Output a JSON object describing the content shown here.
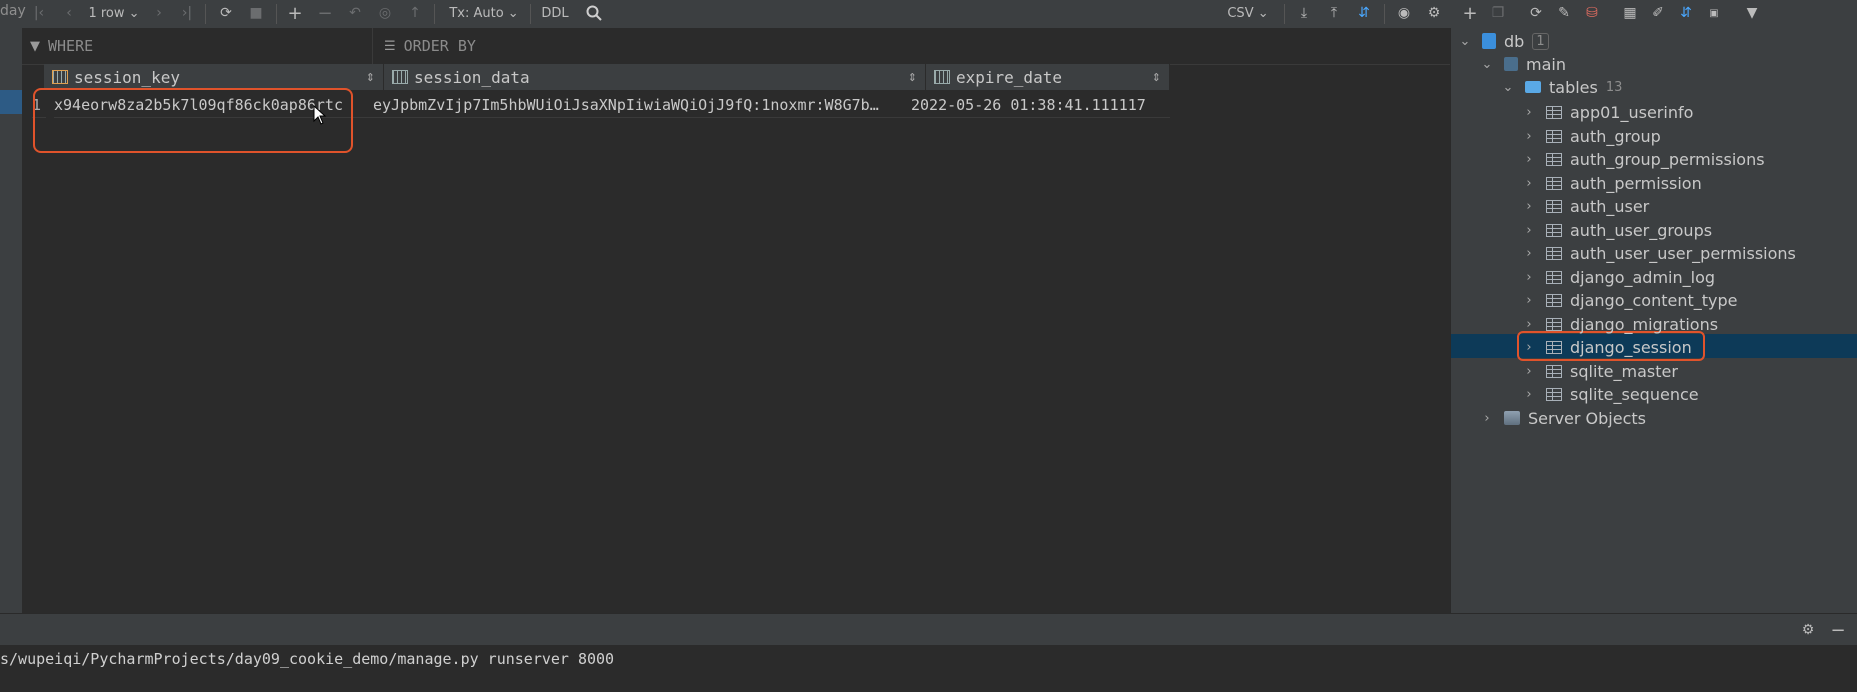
{
  "toolbar": {
    "left_fragment": "day",
    "row_count": "1 row",
    "tx_mode": "Tx: Auto",
    "ddl": "DDL",
    "export_format": "CSV"
  },
  "filters": {
    "where": "WHERE",
    "order_by": "ORDER BY"
  },
  "grid": {
    "columns": [
      "session_key",
      "session_data",
      "expire_date"
    ],
    "rows": [
      {
        "num": "1",
        "session_key": "x94eorw8za2b5k7l09qf86ck0ap86rtc",
        "session_data": "eyJpbmZvIjp7Im5hbWUiOiJsaXNpIiwiaWQiOjJ9fQ:1noxmr:W8G7b…",
        "expire_date": "2022-05-26 01:38:41.111117"
      }
    ]
  },
  "tree": {
    "db": {
      "label": "db",
      "count": "1"
    },
    "schema": "main",
    "tables_folder": {
      "label": "tables",
      "count": "13"
    },
    "tables": [
      "app01_userinfo",
      "auth_group",
      "auth_group_permissions",
      "auth_permission",
      "auth_user",
      "auth_user_groups",
      "auth_user_user_permissions",
      "django_admin_log",
      "django_content_type",
      "django_migrations",
      "django_session",
      "sqlite_master",
      "sqlite_sequence"
    ],
    "selected": "django_session",
    "server_objects": "Server Objects"
  },
  "terminal": {
    "line": "s/wupeiqi/PycharmProjects/day09_cookie_demo/manage.py runserver 8000"
  },
  "colors": {
    "highlight": "#e0532b",
    "selection": "#0d3a58",
    "accent": "#4aa8ff"
  }
}
